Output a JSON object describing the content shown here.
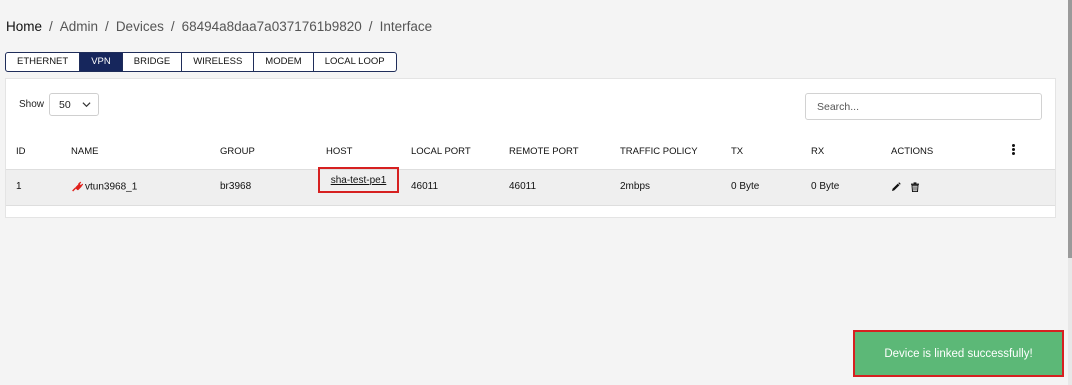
{
  "breadcrumb": {
    "home": "Home",
    "admin": "Admin",
    "devices": "Devices",
    "device_id": "68494a8daa7a0371761b9820",
    "current": "Interface",
    "separator": "/"
  },
  "tabs": [
    {
      "label": "ETHERNET",
      "active": false
    },
    {
      "label": "VPN",
      "active": true
    },
    {
      "label": "BRIDGE",
      "active": false
    },
    {
      "label": "WIRELESS",
      "active": false
    },
    {
      "label": "MODEM",
      "active": false
    },
    {
      "label": "LOCAL LOOP",
      "active": false
    }
  ],
  "table_controls": {
    "show_label": "Show",
    "page_size": "50",
    "search_placeholder": "Search..."
  },
  "table": {
    "columns": [
      "ID",
      "NAME",
      "GROUP",
      "HOST",
      "LOCAL PORT",
      "REMOTE PORT",
      "TRAFFIC POLICY",
      "TX",
      "RX",
      "ACTIONS"
    ],
    "rows": [
      {
        "id": "1",
        "name": "vtun3968_1",
        "group": "br3968",
        "host": "sha-test-pe1",
        "local_port": "46011",
        "remote_port": "46011",
        "traffic_policy": "2mbps",
        "tx": "0 Byte",
        "rx": "0 Byte"
      }
    ]
  },
  "icons": {
    "status": "plug-icon",
    "edit": "pencil-icon",
    "delete": "trash-icon",
    "columns_menu": "kebab-menu-icon",
    "dropdown": "chevron-down-icon"
  },
  "colors": {
    "tab_active_bg": "#16265c",
    "status_icon": "#e0201b",
    "toast_bg": "#5cb877",
    "highlight_border": "#d62020"
  },
  "toast": {
    "message": "Device is linked successfully!"
  }
}
